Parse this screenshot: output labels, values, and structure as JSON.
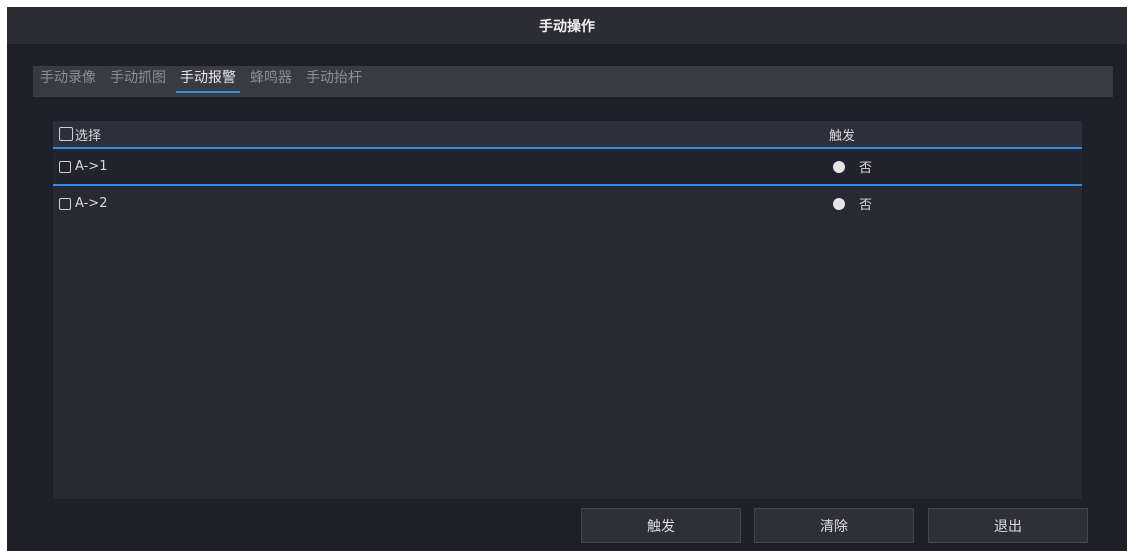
{
  "window": {
    "title": "手动操作"
  },
  "tabs": [
    {
      "label": "手动录像",
      "active": false
    },
    {
      "label": "手动抓图",
      "active": false
    },
    {
      "label": "手动报警",
      "active": true
    },
    {
      "label": "蜂鸣器",
      "active": false
    },
    {
      "label": "手动抬杆",
      "active": false
    }
  ],
  "table": {
    "columns": [
      "选择",
      "触发"
    ],
    "rows": [
      {
        "name": "A->1",
        "trigger": "否",
        "selected": false,
        "highlighted": true
      },
      {
        "name": "A->2",
        "trigger": "否",
        "selected": false,
        "highlighted": false
      }
    ]
  },
  "buttons": {
    "trigger": "触发",
    "clear": "清除",
    "exit": "退出"
  },
  "colors": {
    "accent": "#2f8fe8",
    "background": "#1f1f2a",
    "panel": "#292935"
  }
}
